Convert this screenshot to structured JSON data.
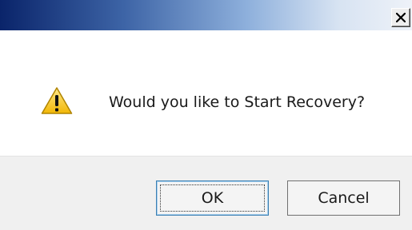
{
  "dialog": {
    "message": "Would you like to Start Recovery?",
    "icon": "warning-icon",
    "close_icon": "close-icon"
  },
  "buttons": {
    "ok_label": "OK",
    "cancel_label": "Cancel"
  },
  "colors": {
    "titlebar_start": "#0a246a",
    "titlebar_end": "#eef2f8",
    "footer_bg": "#f0f0f0",
    "warning_yellow": "#f5c518"
  }
}
